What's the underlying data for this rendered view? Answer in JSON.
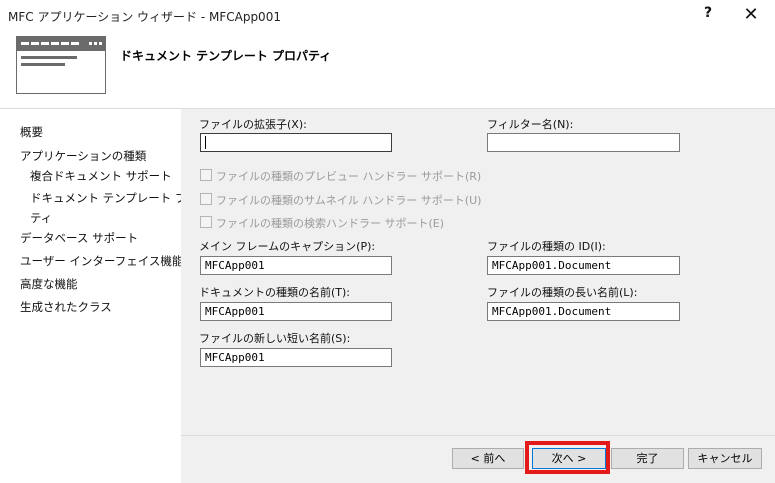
{
  "window": {
    "title": "MFC アプリケーション ウィザード - MFCApp001",
    "help": "?",
    "close": "✕"
  },
  "header": {
    "heading": "ドキュメント テンプレート プロパティ"
  },
  "sidebar": {
    "items": [
      {
        "label": "概要"
      },
      {
        "label": "アプリケーションの種類"
      },
      {
        "label": "複合ドキュメント サポート"
      },
      {
        "label": "ドキュメント テンプレート プロパ"
      },
      {
        "label": "ティ"
      },
      {
        "label": "データベース サポート"
      },
      {
        "label": "ユーザー インターフェイス機能"
      },
      {
        "label": "高度な機能"
      },
      {
        "label": "生成されたクラス"
      }
    ]
  },
  "form": {
    "ext_label": "ファイルの拡張子(X):",
    "ext_value": "",
    "filter_label": "フィルター名(N):",
    "filter_value": "",
    "preview_label": "ファイルの種類のプレビュー ハンドラー サポート(R)",
    "thumbnail_label": "ファイルの種類のサムネイル ハンドラー サポート(U)",
    "search_label": "ファイルの種類の検索ハンドラー サポート(E)",
    "caption_label": "メイン フレームのキャプション(P):",
    "caption_value": "MFCApp001",
    "typeid_label": "ファイルの種類の ID(I):",
    "typeid_value": "MFCApp001.Document",
    "docname_label": "ドキュメントの種類の名前(T):",
    "docname_value": "MFCApp001",
    "longname_label": "ファイルの種類の長い名前(L):",
    "longname_value": "MFCApp001.Document",
    "shortname_label": "ファイルの新しい短い名前(S):",
    "shortname_value": "MFCApp001"
  },
  "footer": {
    "back": "< 前へ",
    "next": "次へ >",
    "finish": "完了",
    "cancel": "キャンセル"
  },
  "colors": {
    "highlight": "#e21a1a",
    "panel": "#f0f0f0",
    "default_button_border": "#0078d7"
  }
}
